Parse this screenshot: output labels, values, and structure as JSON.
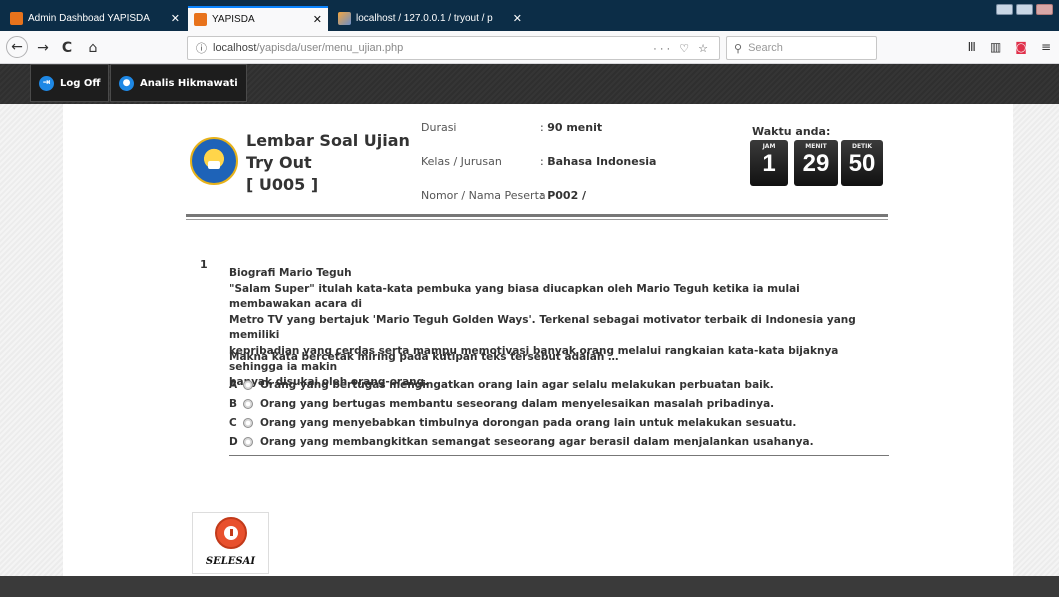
{
  "browser": {
    "tabs": [
      {
        "label": "Admin Dashboad YAPISDA",
        "close": "✕"
      },
      {
        "label": "YAPISDA",
        "close": "✕"
      },
      {
        "label": "localhost / 127.0.0.1 / tryout / p",
        "close": "✕"
      }
    ],
    "url_host": "localhost",
    "url_path": "/yapisda/user/menu_ujian.php",
    "url_actions": "··· ♡ ☆",
    "search_placeholder": "Search",
    "nav": {
      "back": "←",
      "forward": "→",
      "reload": "C",
      "home": "⌂"
    },
    "tools": {
      "library": "Ⅲ",
      "sidebar": "▥",
      "pocket": "◙",
      "menu": "≡"
    }
  },
  "appbar": {
    "logoff_label": "Log Off",
    "user_name": "Analis Hikmawati"
  },
  "header": {
    "title_line1": "Lembar Soal Ujian",
    "title_line2": "Try Out",
    "title_line3": "[ U005 ]",
    "fields": [
      {
        "label": "Durasi",
        "value": "90 menit"
      },
      {
        "label": "Kelas / Jurusan",
        "value": "Bahasa Indonesia"
      },
      {
        "label": "Nomor / Nama Peserta",
        "value": "P002 /"
      }
    ],
    "colon": ": "
  },
  "timer": {
    "label": "Waktu anda:",
    "units": [
      {
        "caption": "JAM",
        "value": "1"
      },
      {
        "caption": "MENIT",
        "value": "29"
      },
      {
        "caption": "DETIK",
        "value": "50"
      }
    ]
  },
  "question": {
    "number": "1",
    "paragraph": [
      "Biografi Mario Teguh",
      "\"Salam Super\" itulah kata-kata pembuka yang biasa diucapkan oleh Mario Teguh ketika ia mulai membawakan acara di",
      "Metro TV yang bertajuk 'Mario Teguh Golden Ways'. Terkenal sebagai motivator terbaik di Indonesia yang memiliki",
      "kepribadian yang cerdas serta mampu memotivasi banyak orang melalui rangkaian kata-kata bijaknya sehingga ia makin",
      "banyak disukai oleh orang-orang."
    ],
    "prompt": "Makna kata bercetak miring pada kutipan teks tersebut adalah …",
    "options": [
      {
        "letter": "A",
        "text": "Orang yang bertugas mengingatkan orang lain agar selalu melakukan perbuatan baik."
      },
      {
        "letter": "B",
        "text": "Orang yang bertugas membantu seseorang dalam menyelesaikan masalah pribadinya."
      },
      {
        "letter": "C",
        "text": "Orang yang menyebabkan timbulnya dorongan pada orang lain untuk melakukan sesuatu."
      },
      {
        "letter": "D",
        "text": "Orang yang membangkitkan semangat seseorang agar berasil dalam menjalankan usahanya."
      }
    ]
  },
  "finish_button": {
    "label": "SELESAI"
  }
}
